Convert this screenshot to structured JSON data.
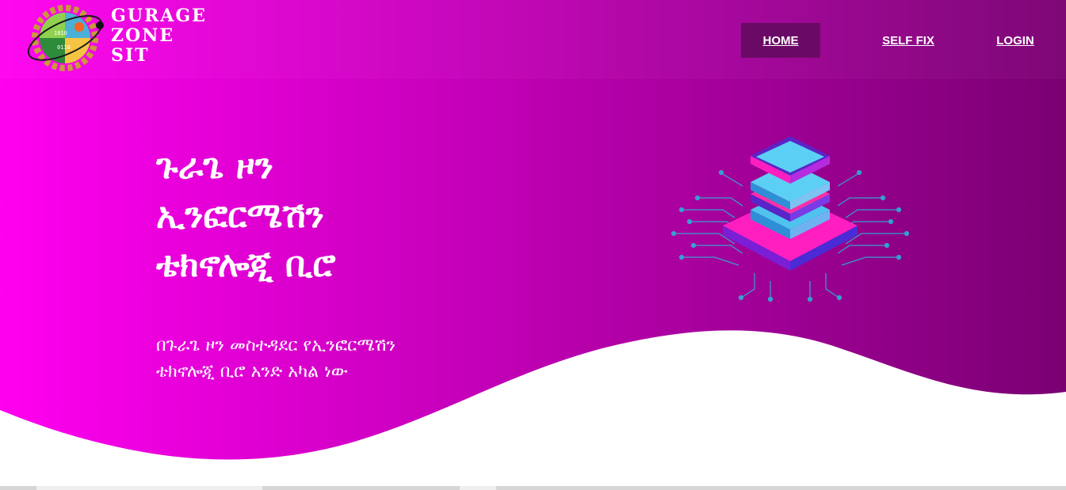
{
  "brand": {
    "line1": "GURAGE",
    "line2": "ZONE",
    "line3": "SIT",
    "logo_icon": "gear-globe-logo-icon"
  },
  "nav": {
    "items": [
      {
        "label": "HOME",
        "active": true
      },
      {
        "label": "SELF FIX",
        "active": false
      },
      {
        "label": "LOGIN",
        "active": false
      }
    ]
  },
  "hero": {
    "title_lines": [
      "ጉራጌ ዞን",
      "ኢንፎርሜሽን",
      "ቴክኖሎጂ ቢሮ"
    ],
    "subtitle_lines": [
      "በጉራጌ ዞን መስተዳደር የኢንፎርሜሽን",
      "ቴክኖሎጂ ቢሮ አንድ አካል ነው"
    ],
    "illustration_icon": "server-circuit-icon"
  },
  "colors": {
    "gradient_start": "#ff00f0",
    "gradient_end": "#7a0072",
    "nav_active": "#6b0a66",
    "text": "#ffffff"
  }
}
